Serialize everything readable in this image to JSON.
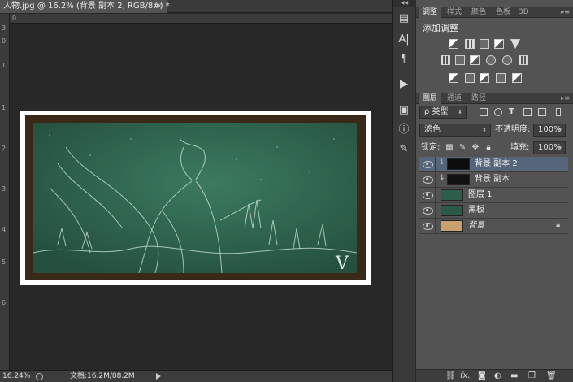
{
  "document": {
    "tab_title": "人物.jpg @ 16.2% (背景 副本 2, RGB/8#) *",
    "close_glyph": "×",
    "zoom": "16.24%",
    "doc_info": "文档:16.2M/88.2M",
    "watermark": "V"
  },
  "rulers": {
    "top_numbers": [
      "0"
    ],
    "left_numbers": [
      "3",
      "0",
      "1",
      "1",
      "2",
      "3",
      "4",
      "5",
      "6"
    ]
  },
  "adjustments_panel": {
    "tabs": [
      "调整",
      "样式",
      "颜色",
      "色板",
      "3D"
    ],
    "title": "添加调整",
    "icons_row1": [
      "brightness-icon",
      "levels-icon",
      "curves-icon",
      "exposure-icon",
      "vibrance-icon"
    ],
    "icons_row2": [
      "hue-saturation-icon",
      "color-balance-icon",
      "black-white-icon",
      "photo-filter-icon",
      "channel-mixer-icon",
      "color-lookup-icon"
    ],
    "icons_row3": [
      "invert-icon",
      "posterize-icon",
      "threshold-icon",
      "selective-color-icon",
      "gradient-map-icon"
    ]
  },
  "layers_panel": {
    "tabs": [
      "图层",
      "通道",
      "路径"
    ],
    "filter_kind": "类型",
    "filter_icon": "ρ",
    "blend_mode": "滤色",
    "opacity_label": "不透明度:",
    "opacity_value": "100%",
    "lock_label": "锁定:",
    "fill_label": "填充:",
    "fill_value": "100%",
    "layers": [
      {
        "name": "背景 副本 2",
        "clipped": true,
        "selected": true,
        "thumb": "#0d0d0d",
        "italic": false,
        "locked": false
      },
      {
        "name": "背景 副本",
        "clipped": true,
        "selected": false,
        "thumb": "#121212",
        "italic": false,
        "locked": false
      },
      {
        "name": "图层 1",
        "clipped": false,
        "selected": false,
        "thumb": "#2e5e4b",
        "italic": false,
        "locked": false
      },
      {
        "name": "黑板",
        "clipped": false,
        "selected": false,
        "thumb": "#2c5a47",
        "italic": false,
        "locked": false
      },
      {
        "name": "背景",
        "clipped": false,
        "selected": false,
        "thumb": "#c9a070",
        "italic": true,
        "locked": true
      }
    ],
    "bottom_icons": [
      "link-icon",
      "fx-icon",
      "mask-icon",
      "adjustment-icon",
      "folder-icon",
      "new-layer-icon",
      "trash-icon"
    ],
    "fx_label": "fx."
  },
  "colors": {
    "accent_selected": "#56657a",
    "board_green": "#2c5c48",
    "frame_brown": "#3a2818"
  }
}
